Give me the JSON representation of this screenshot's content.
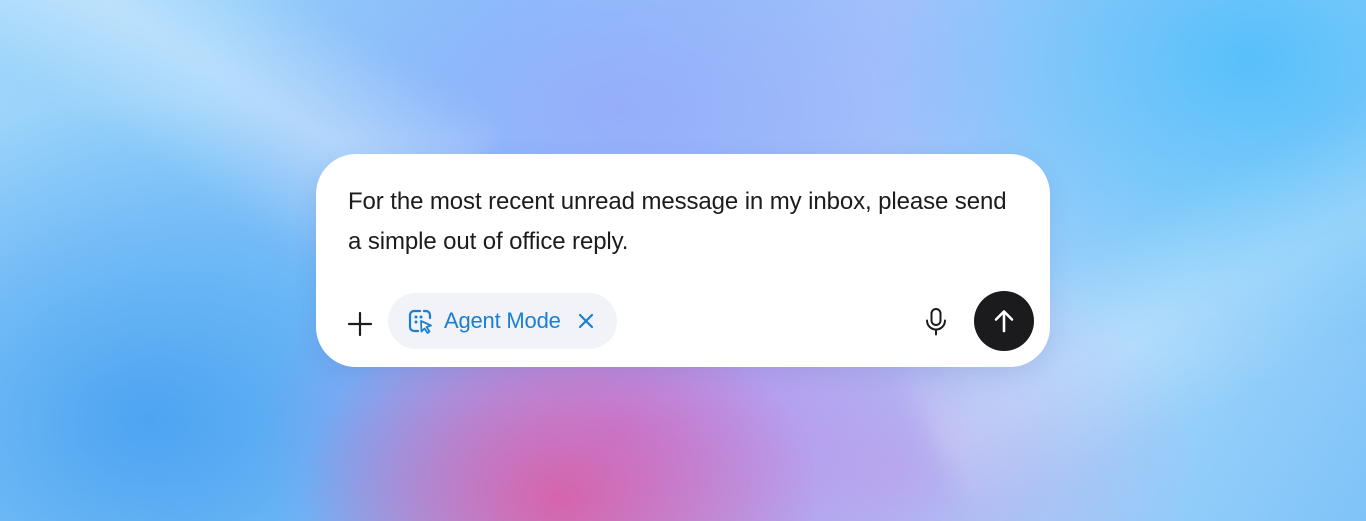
{
  "composer": {
    "prompt_text": "For the most recent unread message in my inbox, please send a simple out of office reply.",
    "add_icon": "plus-icon",
    "mode_chip": {
      "label": "Agent Mode",
      "icon": "agent-cursor-icon",
      "remove_icon": "close-icon",
      "color": "#1a7fd4"
    },
    "mic_icon": "microphone-icon",
    "send_icon": "arrow-up-icon",
    "send_button_color": "#1b1b1d"
  }
}
